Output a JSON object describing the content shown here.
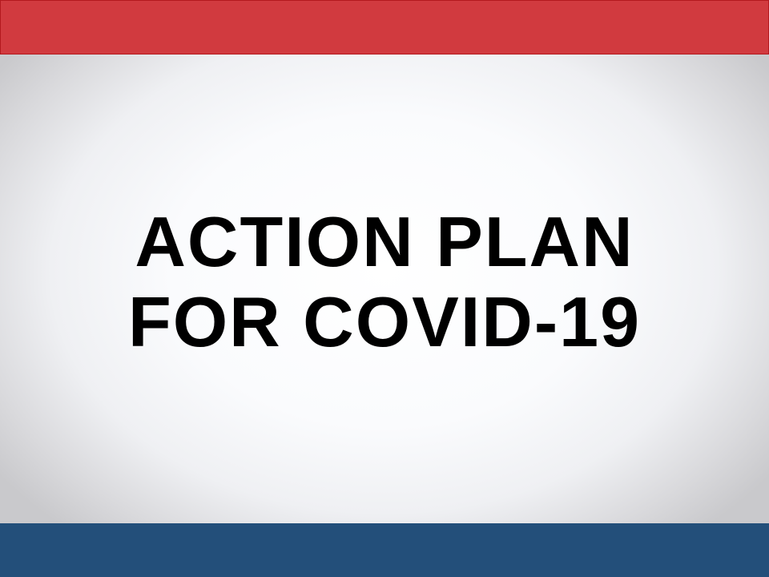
{
  "slide": {
    "title_lines": [
      "ACTION PLAN",
      "FOR COVID-19"
    ]
  },
  "colors": {
    "top_band": "#d13a3f",
    "bottom_band": "#234f7a",
    "title_text": "#000000"
  }
}
